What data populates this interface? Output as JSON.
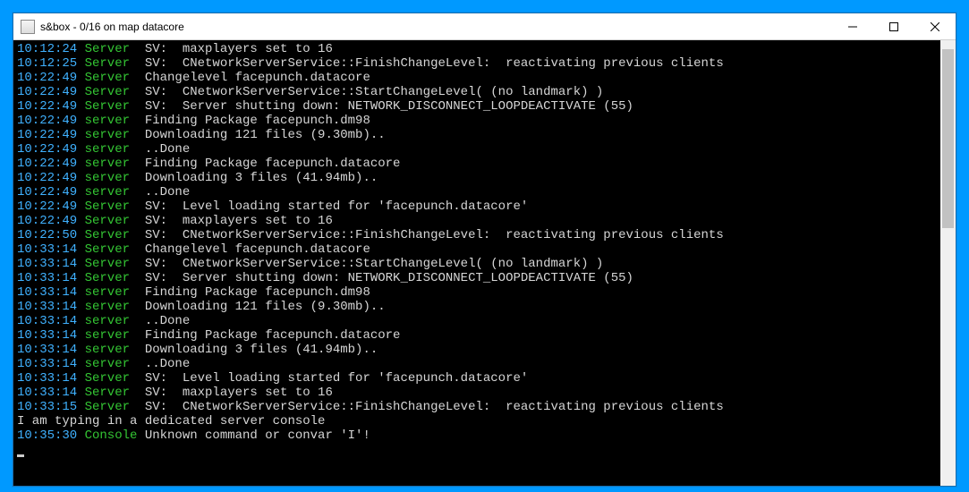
{
  "window": {
    "title": "s&box -  0/16 on map datacore"
  },
  "lines": [
    {
      "ts": "10:12:24",
      "src": "Server",
      "msg": "SV:  maxplayers set to 16"
    },
    {
      "ts": "10:12:25",
      "src": "Server",
      "msg": "SV:  CNetworkServerService::FinishChangeLevel:  reactivating previous clients"
    },
    {
      "ts": "10:22:49",
      "src": "Server",
      "msg": "Changelevel facepunch.datacore"
    },
    {
      "ts": "10:22:49",
      "src": "Server",
      "msg": "SV:  CNetworkServerService::StartChangeLevel( (no landmark) )"
    },
    {
      "ts": "10:22:49",
      "src": "Server",
      "msg": "SV:  Server shutting down: NETWORK_DISCONNECT_LOOPDEACTIVATE (55)"
    },
    {
      "ts": "10:22:49",
      "src": "server",
      "msg": "Finding Package facepunch.dm98"
    },
    {
      "ts": "10:22:49",
      "src": "server",
      "msg": "Downloading 121 files (9.30mb).."
    },
    {
      "ts": "10:22:49",
      "src": "server",
      "msg": "..Done"
    },
    {
      "ts": "10:22:49",
      "src": "server",
      "msg": "Finding Package facepunch.datacore"
    },
    {
      "ts": "10:22:49",
      "src": "server",
      "msg": "Downloading 3 files (41.94mb).."
    },
    {
      "ts": "10:22:49",
      "src": "server",
      "msg": "..Done"
    },
    {
      "ts": "10:22:49",
      "src": "Server",
      "msg": "SV:  Level loading started for 'facepunch.datacore'"
    },
    {
      "ts": "10:22:49",
      "src": "Server",
      "msg": "SV:  maxplayers set to 16"
    },
    {
      "ts": "10:22:50",
      "src": "Server",
      "msg": "SV:  CNetworkServerService::FinishChangeLevel:  reactivating previous clients"
    },
    {
      "ts": "10:33:14",
      "src": "Server",
      "msg": "Changelevel facepunch.datacore"
    },
    {
      "ts": "10:33:14",
      "src": "Server",
      "msg": "SV:  CNetworkServerService::StartChangeLevel( (no landmark) )"
    },
    {
      "ts": "10:33:14",
      "src": "Server",
      "msg": "SV:  Server shutting down: NETWORK_DISCONNECT_LOOPDEACTIVATE (55)"
    },
    {
      "ts": "10:33:14",
      "src": "server",
      "msg": "Finding Package facepunch.dm98"
    },
    {
      "ts": "10:33:14",
      "src": "server",
      "msg": "Downloading 121 files (9.30mb).."
    },
    {
      "ts": "10:33:14",
      "src": "server",
      "msg": "..Done"
    },
    {
      "ts": "10:33:14",
      "src": "server",
      "msg": "Finding Package facepunch.datacore"
    },
    {
      "ts": "10:33:14",
      "src": "server",
      "msg": "Downloading 3 files (41.94mb).."
    },
    {
      "ts": "10:33:14",
      "src": "server",
      "msg": "..Done"
    },
    {
      "ts": "10:33:14",
      "src": "Server",
      "msg": "SV:  Level loading started for 'facepunch.datacore'"
    },
    {
      "ts": "10:33:14",
      "src": "Server",
      "msg": "SV:  maxplayers set to 16"
    },
    {
      "ts": "10:33:15",
      "src": "Server",
      "msg": "SV:  CNetworkServerService::FinishChangeLevel:  reactivating previous clients"
    },
    {
      "raw": "I am typing in a dedicated server console"
    },
    {
      "ts": "10:35:30",
      "src": "Console",
      "msg": "Unknown command or convar 'I'!"
    }
  ]
}
